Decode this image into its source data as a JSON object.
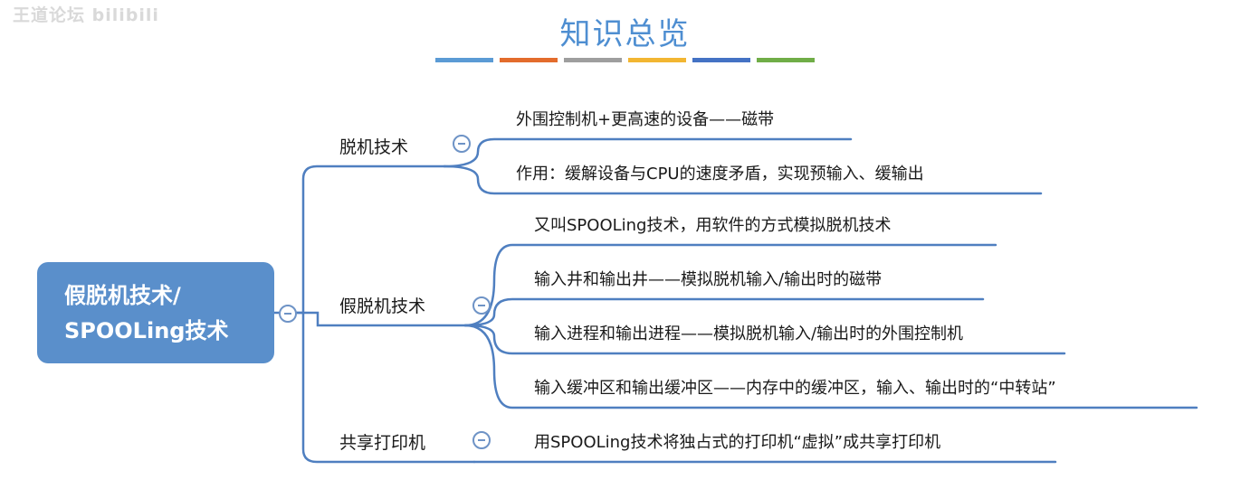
{
  "watermark": "王道论坛 bilibili",
  "title": "知识总览",
  "title_underline_colors": [
    "#5b9bd5",
    "#e36c2c",
    "#9e9e9e",
    "#f2b632",
    "#4472c4",
    "#70ad47"
  ],
  "colors": {
    "root_fill": "#5a8fcb",
    "branch_line": "#4f7fc0",
    "title": "#4e8ed1"
  },
  "root": {
    "line1": "假脱机技术/",
    "line2": "SPOOLing技术"
  },
  "branches": [
    {
      "label": "脱机技术",
      "children": [
        "外围控制机+更高速的设备——磁带",
        "作用：缓解设备与CPU的速度矛盾，实现预输入、缓输出"
      ]
    },
    {
      "label": "假脱机技术",
      "children": [
        "又叫SPOOLing技术，用软件的方式模拟脱机技术",
        "输入井和输出井——模拟脱机输入/输出时的磁带",
        "输入进程和输出进程——模拟脱机输入/输出时的外围控制机",
        "输入缓冲区和输出缓冲区——内存中的缓冲区，输入、输出时的“中转站”"
      ]
    },
    {
      "label": "共享打印机",
      "children": [
        "用SPOOLing技术将独占式的打印机“虚拟”成共享打印机"
      ]
    }
  ],
  "toggle_icon": "collapse-minus-icon"
}
